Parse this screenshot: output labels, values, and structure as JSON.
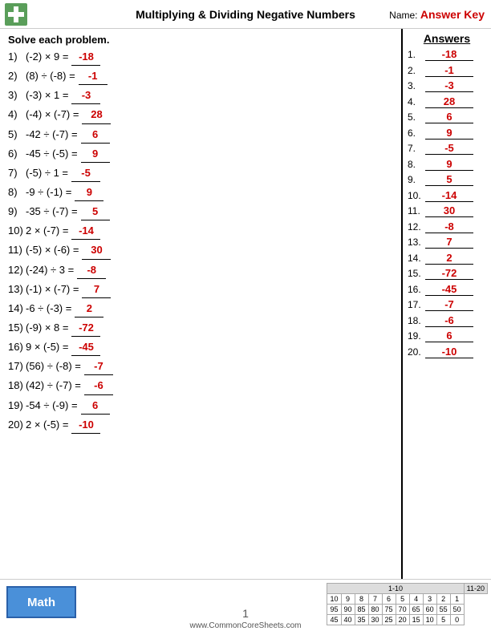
{
  "header": {
    "title": "Multiplying & Dividing Negative Numbers",
    "name_label": "Name:",
    "answer_key": "Answer Key",
    "logo_color": "#4a7c3f"
  },
  "problems": {
    "solve_label": "Solve each problem.",
    "items": [
      {
        "num": "1)",
        "expr": "(-2) × 9 =",
        "answer": "-18"
      },
      {
        "num": "2)",
        "expr": "(8) ÷ (-8) =",
        "answer": "-1"
      },
      {
        "num": "3)",
        "expr": "(-3) × 1 =",
        "answer": "-3"
      },
      {
        "num": "4)",
        "expr": "(-4) × (-7) =",
        "answer": "28"
      },
      {
        "num": "5)",
        "expr": "-42 ÷ (-7) =",
        "answer": "6"
      },
      {
        "num": "6)",
        "expr": "-45 ÷ (-5) =",
        "answer": "9"
      },
      {
        "num": "7)",
        "expr": "(-5) ÷ 1 =",
        "answer": "-5"
      },
      {
        "num": "8)",
        "expr": "-9 ÷ (-1) =",
        "answer": "9"
      },
      {
        "num": "9)",
        "expr": "-35 ÷ (-7) =",
        "answer": "5"
      },
      {
        "num": "10)",
        "expr": "2 × (-7) =",
        "answer": "-14"
      },
      {
        "num": "11)",
        "expr": "(-5) × (-6) =",
        "answer": "30"
      },
      {
        "num": "12)",
        "expr": "(-24) ÷ 3 =",
        "answer": "-8"
      },
      {
        "num": "13)",
        "expr": "(-1) × (-7) =",
        "answer": "7"
      },
      {
        "num": "14)",
        "expr": "-6 ÷ (-3) =",
        "answer": "2"
      },
      {
        "num": "15)",
        "expr": "(-9) × 8 =",
        "answer": "-72"
      },
      {
        "num": "16)",
        "expr": "9 × (-5) =",
        "answer": "-45"
      },
      {
        "num": "17)",
        "expr": "(56) ÷ (-8) =",
        "answer": "-7"
      },
      {
        "num": "18)",
        "expr": "(42) ÷ (-7) =",
        "answer": "-6"
      },
      {
        "num": "19)",
        "expr": "-54 ÷ (-9) =",
        "answer": "6"
      },
      {
        "num": "20)",
        "expr": "2 × (-5) =",
        "answer": "-10"
      }
    ]
  },
  "answers": {
    "header": "Answers",
    "items": [
      {
        "num": "1.",
        "val": "-18"
      },
      {
        "num": "2.",
        "val": "-1"
      },
      {
        "num": "3.",
        "val": "-3"
      },
      {
        "num": "4.",
        "val": "28"
      },
      {
        "num": "5.",
        "val": "6"
      },
      {
        "num": "6.",
        "val": "9"
      },
      {
        "num": "7.",
        "val": "-5"
      },
      {
        "num": "8.",
        "val": "9"
      },
      {
        "num": "9.",
        "val": "5"
      },
      {
        "num": "10.",
        "val": "-14"
      },
      {
        "num": "11.",
        "val": "30"
      },
      {
        "num": "12.",
        "val": "-8"
      },
      {
        "num": "13.",
        "val": "7"
      },
      {
        "num": "14.",
        "val": "2"
      },
      {
        "num": "15.",
        "val": "-72"
      },
      {
        "num": "16.",
        "val": "-45"
      },
      {
        "num": "17.",
        "val": "-7"
      },
      {
        "num": "18.",
        "val": "-6"
      },
      {
        "num": "19.",
        "val": "6"
      },
      {
        "num": "20.",
        "val": "-10"
      }
    ]
  },
  "footer": {
    "math_label": "Math",
    "website": "www.CommonCoreSheets.com",
    "page_num": "1",
    "scoring": {
      "ranges": [
        "1-10",
        "11-20"
      ],
      "scores": [
        [
          "95",
          "90",
          "85",
          "80",
          "75",
          "70",
          "65",
          "60",
          "55",
          "50"
        ],
        [
          "45",
          "40",
          "35",
          "30",
          "25",
          "20",
          "15",
          "10",
          "5",
          "0"
        ]
      ],
      "range_scores": [
        "10",
        "9",
        "8",
        "7",
        "6",
        "5",
        "4",
        "3",
        "2",
        "1"
      ]
    }
  }
}
